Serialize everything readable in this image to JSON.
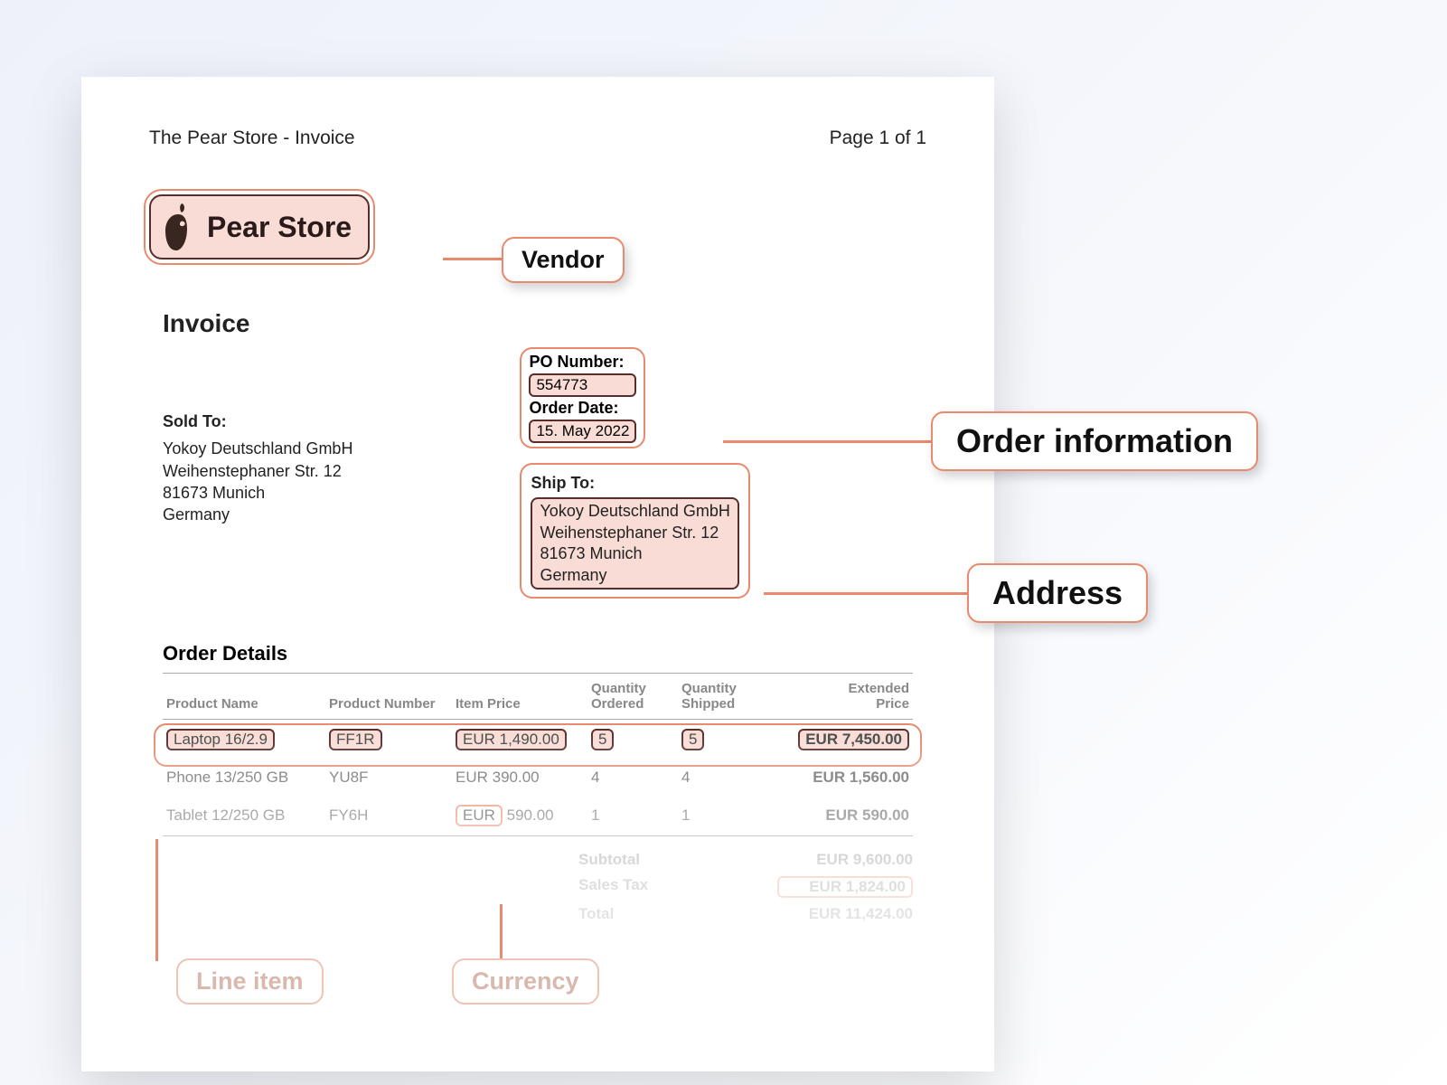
{
  "header": {
    "title": "The Pear Store - Invoice",
    "page_indicator": "Page 1 of 1"
  },
  "vendor": {
    "name": "Pear Store"
  },
  "invoice_title": "Invoice",
  "order_info": {
    "po_label": "PO Number:",
    "po_number": "554773",
    "date_label": "Order Date:",
    "order_date": "15. May 2022"
  },
  "sold_to": {
    "label": "Sold To:",
    "name": "Yokoy Deutschland GmbH",
    "street": "Weihenstephaner Str. 12",
    "city": "81673 Munich",
    "country": "Germany"
  },
  "ship_to": {
    "label": "Ship To:",
    "name": "Yokoy Deutschland GmbH",
    "street": "Weihenstephaner Str. 12",
    "city": "81673 Munich",
    "country": "Germany"
  },
  "order_details": {
    "heading": "Order Details",
    "columns": {
      "product_name": "Product Name",
      "product_number": "Product Number",
      "item_price": "Item Price",
      "qty_ordered_1": "Quantity",
      "qty_ordered_2": "Ordered",
      "qty_shipped_1": "Quantity",
      "qty_shipped_2": "Shipped",
      "ext_1": "Extended",
      "ext_2": "Price"
    },
    "rows": [
      {
        "name": "Laptop 16/2.9",
        "number": "FF1R",
        "price": "EUR 1,490.00",
        "qo": "5",
        "qs": "5",
        "ext": "EUR 7,450.00"
      },
      {
        "name": "Phone 13/250 GB",
        "number": "YU8F",
        "price": "EUR 390.00",
        "qo": "4",
        "qs": "4",
        "ext": "EUR 1,560.00"
      },
      {
        "name": "Tablet 12/250 GB",
        "number": "FY6H",
        "price_pre": "EUR",
        "price_post": "590.00",
        "qo": "1",
        "qs": "1",
        "ext": "EUR 590.00"
      }
    ]
  },
  "totals": {
    "subtotal_label": "Subtotal",
    "subtotal": "EUR 9,600.00",
    "tax_label": "Sales Tax",
    "tax": "EUR 1,824.00",
    "total_label": "Total",
    "total": "EUR 11,424.00"
  },
  "annotations": {
    "vendor": "Vendor",
    "order_info": "Order information",
    "address": "Address",
    "line_item": "Line item",
    "currency": "Currency"
  }
}
